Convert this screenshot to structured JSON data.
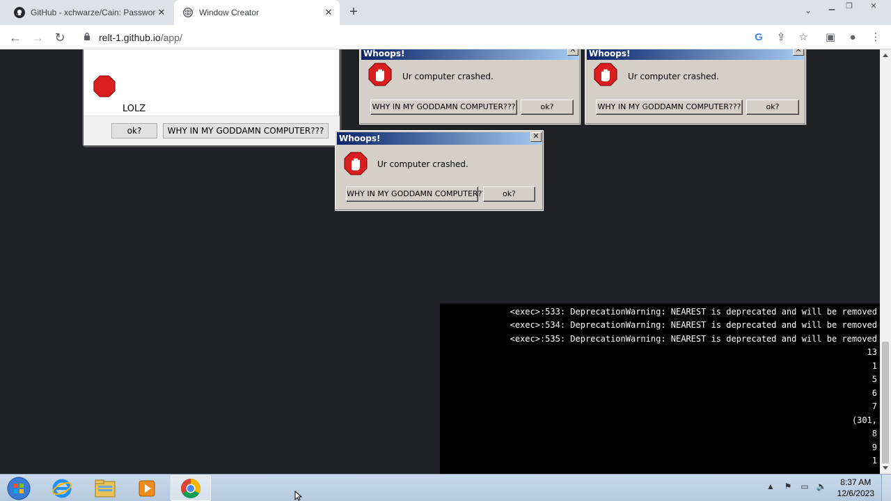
{
  "browser": {
    "tabs": [
      {
        "title": "GitHub - xchwarze/Cain: Passwor",
        "icon": "github-icon"
      },
      {
        "title": "Window Creator",
        "icon": "globe-icon"
      }
    ],
    "url_host": "relt-1.github.io",
    "url_path": "/app/"
  },
  "dialogs": [
    {
      "title": "",
      "message": "LOLZ",
      "buttons": [
        "ok?",
        "WHY IN MY GODDAMN COMPUTER???"
      ]
    },
    {
      "title": "Whoops!",
      "message": "Ur computer crashed.",
      "buttons": [
        "WHY IN MY GODDAMN COMPUTER???",
        "ok?"
      ]
    },
    {
      "title": "Whoops!",
      "message": "Ur computer crashed.",
      "buttons": [
        "WHY IN MY GODDAMN COMPUTER???",
        "ok?"
      ]
    },
    {
      "title": "Whoops!",
      "message": "Ur computer crashed.",
      "buttons": [
        "WHY IN MY GODDAMN COMPUTER???",
        "ok?"
      ]
    }
  ],
  "terminal": {
    "lines": [
      "<exec>:533: DeprecationWarning: NEAREST is deprecated and will be removed",
      "<exec>:534: DeprecationWarning: NEAREST is deprecated and will be removed",
      "<exec>:535: DeprecationWarning: NEAREST is deprecated and will be removed",
      "13",
      "1",
      "5",
      "6",
      "7",
      "(301,",
      "8",
      "9",
      "1"
    ]
  },
  "taskbar": {
    "time": "8:37 AM",
    "date": "12/6/2023"
  },
  "colors": {
    "page_bg": "#202124",
    "dialog_bg": "#d4d0c8",
    "titlebar_start": "#0a246a",
    "titlebar_end": "#a6caf0",
    "stop_red": "#d81e1e"
  }
}
